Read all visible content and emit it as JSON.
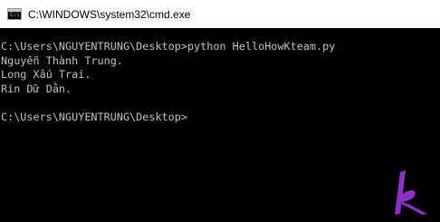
{
  "window": {
    "title": "C:\\WINDOWS\\system32\\cmd.exe",
    "icon": "console-icon",
    "background_color": "#000000",
    "text_color": "#c0c0c0"
  },
  "console": {
    "lines": [
      "C:\\Users\\NGUYENTRUNG\\Desktop>python HelloHowKteam.py",
      "Nguyễn Thành Trung.",
      "Long Xấu Trai.",
      "Rin Dữ Dằn.",
      "",
      "C:\\Users\\NGUYENTRUNG\\Desktop>"
    ]
  },
  "watermark": {
    "icon": "howkteam-logo-icon",
    "color": "#8b2fc9"
  }
}
